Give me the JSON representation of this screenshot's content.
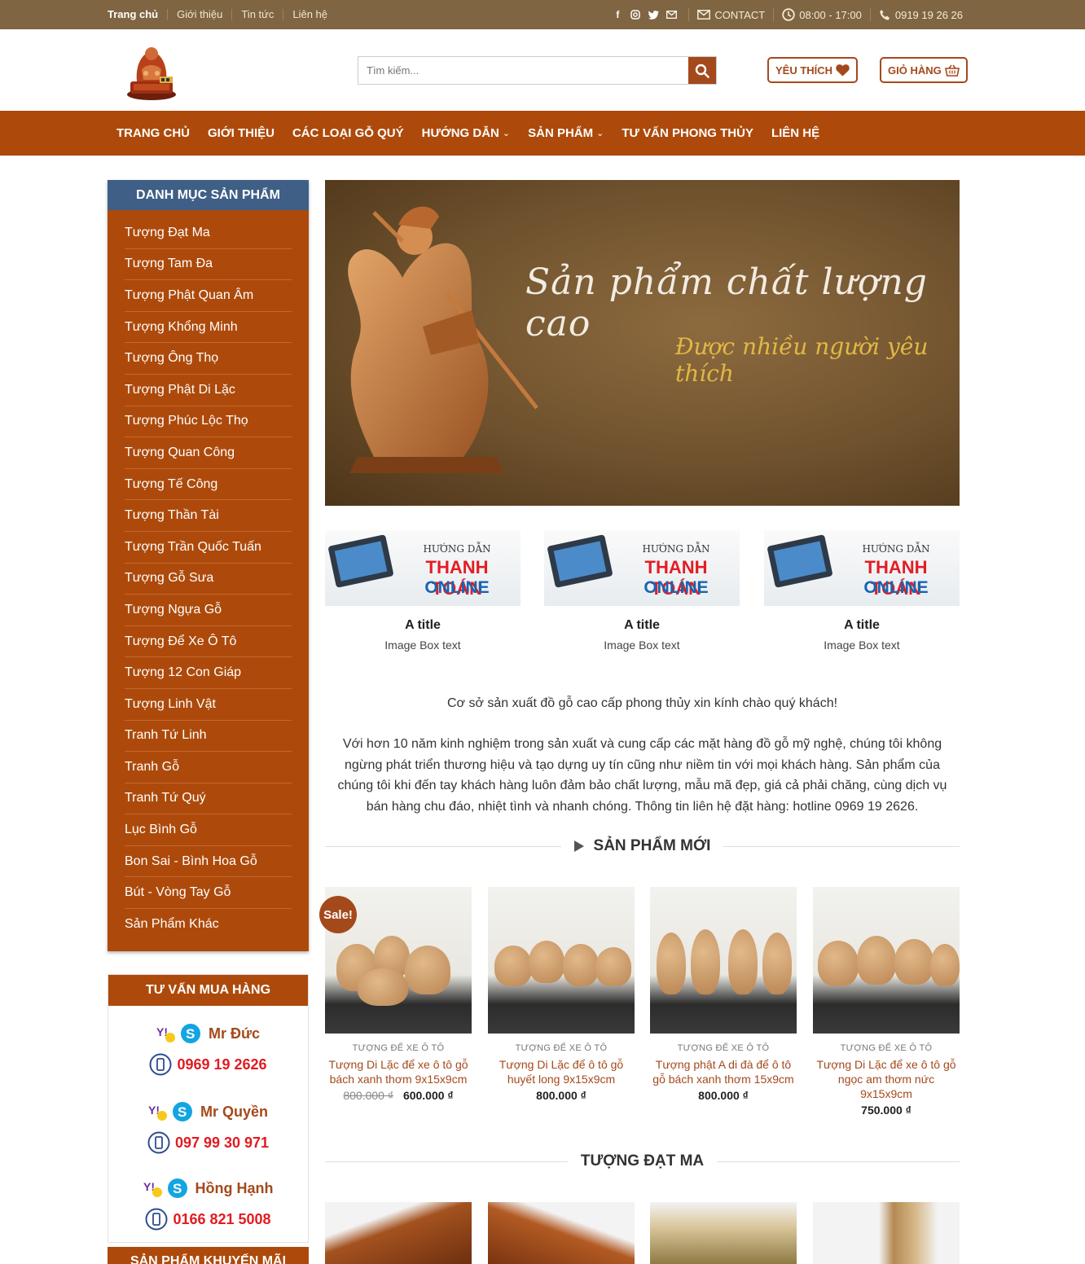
{
  "topbar": {
    "links": [
      "Trang chủ",
      "Giới thiệu",
      "Tin tức",
      "Liên hệ"
    ],
    "social_icons": [
      "facebook-icon",
      "instagram-icon",
      "twitter-icon",
      "mail-icon"
    ],
    "contact_label": "CONTACT",
    "hours": "08:00 - 17:00",
    "phone": "0919 19 26 26"
  },
  "header": {
    "search_placeholder": "Tìm kiếm...",
    "wishlist_label": "YÊU THÍCH",
    "cart_label": "GIỎ HÀNG"
  },
  "nav": {
    "items": [
      {
        "label": "TRANG CHỦ",
        "dropdown": false
      },
      {
        "label": "GIỚI THIỆU",
        "dropdown": false
      },
      {
        "label": "CÁC LOẠI GỖ QUÝ",
        "dropdown": false
      },
      {
        "label": "HƯỚNG DẪN",
        "dropdown": true
      },
      {
        "label": "SẢN PHẨM",
        "dropdown": true
      },
      {
        "label": "TƯ VẤN PHONG THỦY",
        "dropdown": false
      },
      {
        "label": "LIÊN HỆ",
        "dropdown": false
      }
    ]
  },
  "sidebar": {
    "category_title": "DANH MỤC SẢN PHẨM",
    "categories": [
      "Tượng Đạt Ma",
      "Tượng Tam Đa",
      "Tượng Phật Quan Âm",
      "Tượng Khổng Minh",
      "Tượng Ông Thọ",
      "Tượng Phật Di Lặc",
      "Tượng Phúc Lộc Thọ",
      "Tượng Quan Công",
      "Tượng Tế Công",
      "Tượng Thần Tài",
      "Tượng Trần Quốc Tuấn",
      "Tượng Gỗ Sưa",
      "Tượng Ngựa Gỗ",
      "Tượng Để Xe Ô Tô",
      "Tượng 12 Con Giáp",
      "Tượng Linh Vật",
      "Tranh Tứ Linh",
      "Tranh Gỗ",
      "Tranh Tứ Quý",
      "Lục Bình Gỗ",
      "Bon Sai - Bình Hoa Gỗ",
      "Bút - Vòng Tay Gỗ",
      "Sản Phẩm Khác"
    ],
    "advice_title": "TƯ VẤN MUA HÀNG",
    "contacts": [
      {
        "name": "Mr Đức",
        "phone": "0969 19 2626"
      },
      {
        "name": "Mr Quyền",
        "phone": "097 99 30 971"
      },
      {
        "name": "Hồng Hạnh",
        "phone": "0166 821 5008"
      }
    ],
    "promo_title": "SẢN PHẨM KHUYẾN MÃI"
  },
  "banner": {
    "headline": "Sản phẩm chất lượng cao",
    "subline": "Được nhiều người yêu thích"
  },
  "image_boxes": [
    {
      "img_heading": "HƯỚNG DẪN",
      "img_title": "THANH TOÁN",
      "img_sub": "ONLINE",
      "title": "A title",
      "text": "Image Box text"
    },
    {
      "img_heading": "HƯỚNG DẪN",
      "img_title": "THANH TOÁN",
      "img_sub": "ONLINE",
      "title": "A title",
      "text": "Image Box text"
    },
    {
      "img_heading": "HƯỚNG DẪN",
      "img_title": "THANH TOÁN",
      "img_sub": "ONLINE",
      "title": "A title",
      "text": "Image Box text"
    }
  ],
  "intro": {
    "welcome": "Cơ sở sản xuất đồ gỗ cao cấp phong thủy xin kính chào quý khách!",
    "about": "Với hơn 10 năm kinh nghiệm trong sản xuất và cung cấp các mặt hàng đồ gỗ mỹ nghệ, chúng tôi không ngừng phát triển thương hiệu và tạo dựng uy tín cũng như niềm tin với mọi khách hàng. Sản phẩm của chúng tôi khi đến tay khách hàng luôn đảm bảo chất lượng, mẫu mã đẹp, giá cả phải chăng, cùng dịch vụ bán hàng chu đáo, nhiệt tình và nhanh chóng. Thông tin liên hệ đặt hàng: hotline 0969 19 2626."
  },
  "new_products": {
    "title": "SẢN PHẨM MỚI",
    "sale_badge": "Sale!",
    "items": [
      {
        "category": "TƯỢNG ĐỂ XE Ô TÔ",
        "name": "Tượng Di Lặc để xe ô tô gỗ bách xanh thơm 9x15x9cm",
        "old_price": "800.000 ₫",
        "price": "600.000 ₫"
      },
      {
        "category": "TƯỢNG ĐỂ XE Ô TÔ",
        "name": "Tượng Di Lặc để ô tô gỗ huyết long 9x15x9cm",
        "old_price": "",
        "price": "800.000 ₫"
      },
      {
        "category": "TƯỢNG ĐỂ XE Ô TÔ",
        "name": "Tượng phật A di đà để ô tô gỗ bách xanh thơm 15x9cm",
        "old_price": "",
        "price": "800.000 ₫"
      },
      {
        "category": "TƯỢNG ĐỂ XE Ô TÔ",
        "name": "Tượng Di Lặc để xe ô tô gỗ ngọc am thơm nức 9x15x9cm",
        "old_price": "",
        "price": "750.000 ₫"
      }
    ]
  },
  "dat_ma_section": {
    "title": "TƯỢNG ĐẠT MA"
  },
  "colors": {
    "brand": "#ad4a0b",
    "topbar": "#7f6541",
    "category_header": "#3f5f86",
    "phone_red": "#e11b22"
  }
}
